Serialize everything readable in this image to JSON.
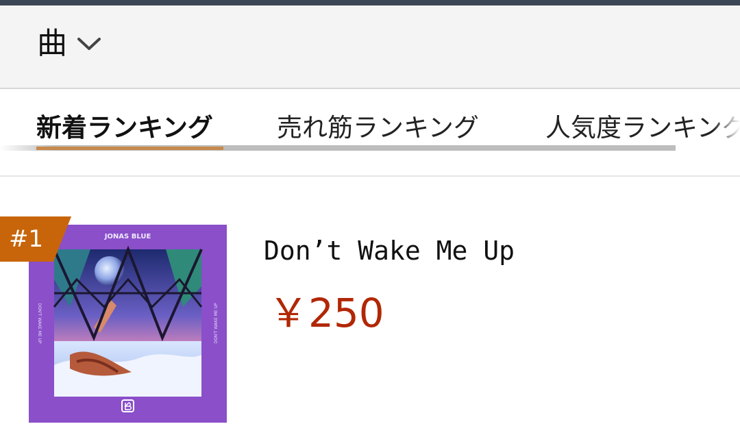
{
  "header": {
    "category_label": "曲"
  },
  "tabs": [
    {
      "label": "新着ランキング",
      "active": true
    },
    {
      "label": "売れ筋ランキング",
      "active": false
    },
    {
      "label": "人気度ランキング",
      "active": false
    }
  ],
  "items": [
    {
      "rank": "#1",
      "title": "Don’t Wake Me Up",
      "price": "￥250",
      "cover_top_text": "JONAS BLUE",
      "cover_side_text": "DON'T WAKE ME UP"
    }
  ],
  "colors": {
    "accent": "#c68a4d",
    "rank_badge": "#c8650a",
    "price": "#b12704",
    "topbar": "#3c4654",
    "cover_bg": "#8a4fc9"
  },
  "icons": {
    "dropdown": "chevron-down-icon",
    "cover_logo": "label-logo-icon"
  }
}
